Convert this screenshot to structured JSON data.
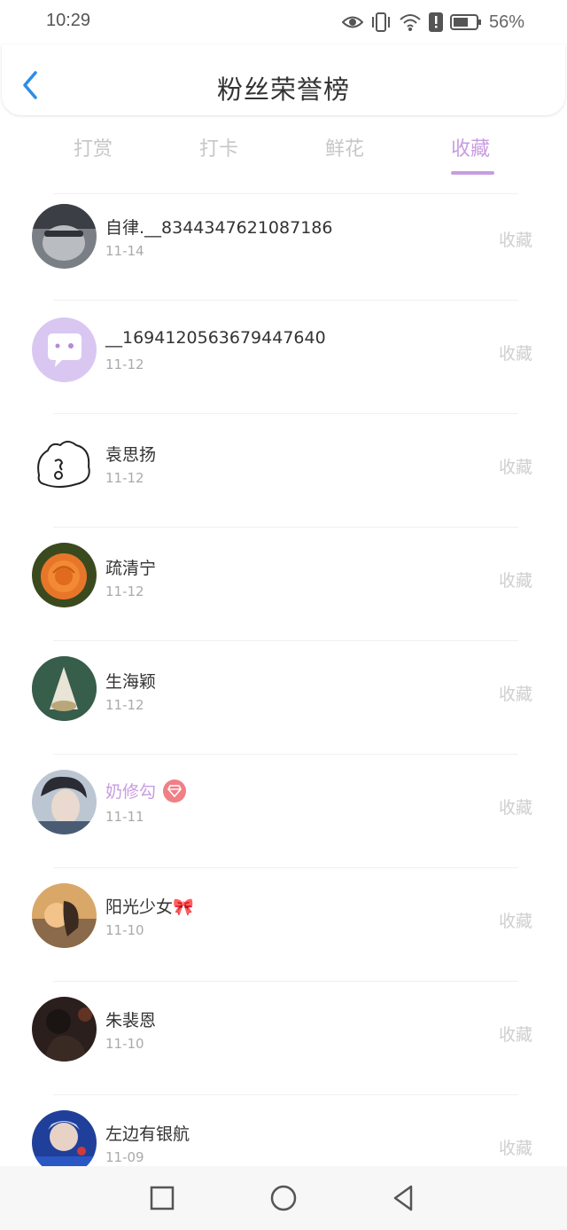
{
  "status": {
    "time": "10:29",
    "battery": "56%"
  },
  "header": {
    "title": "粉丝荣誉榜"
  },
  "tabs": [
    {
      "label": "打赏"
    },
    {
      "label": "打卡"
    },
    {
      "label": "鲜花"
    },
    {
      "label": "收藏",
      "active": true
    }
  ],
  "fans": [
    {
      "name": "自律.__8344347621087186",
      "date": "11-14",
      "action": "收藏",
      "avatar": "portrait-mask"
    },
    {
      "name": "__1694120563679447640",
      "date": "11-12",
      "action": "收藏",
      "avatar": "default-chat"
    },
    {
      "name": "袁思扬",
      "date": "11-12",
      "action": "收藏",
      "avatar": "cartoon-bear"
    },
    {
      "name": "疏清宁",
      "date": "11-12",
      "action": "收藏",
      "avatar": "orange-rose"
    },
    {
      "name": "生海颖",
      "date": "11-12",
      "action": "收藏",
      "avatar": "forest-lantern"
    },
    {
      "name": "奶修勾",
      "date": "11-11",
      "action": "收藏",
      "avatar": "portrait-boy",
      "vip": true
    },
    {
      "name": "阳光少女🎀",
      "date": "11-10",
      "action": "收藏",
      "avatar": "sunset-girl"
    },
    {
      "name": "朱裴恩",
      "date": "11-10",
      "action": "收藏",
      "avatar": "dark-portrait"
    },
    {
      "name": "左边有银航",
      "date": "11-09",
      "action": "收藏",
      "avatar": "singer-blue"
    }
  ],
  "colors": {
    "accent": "#c79de0",
    "muted": "#cfcfcf",
    "back": "#2d8ce8",
    "vip_badge": "#f07f86"
  }
}
